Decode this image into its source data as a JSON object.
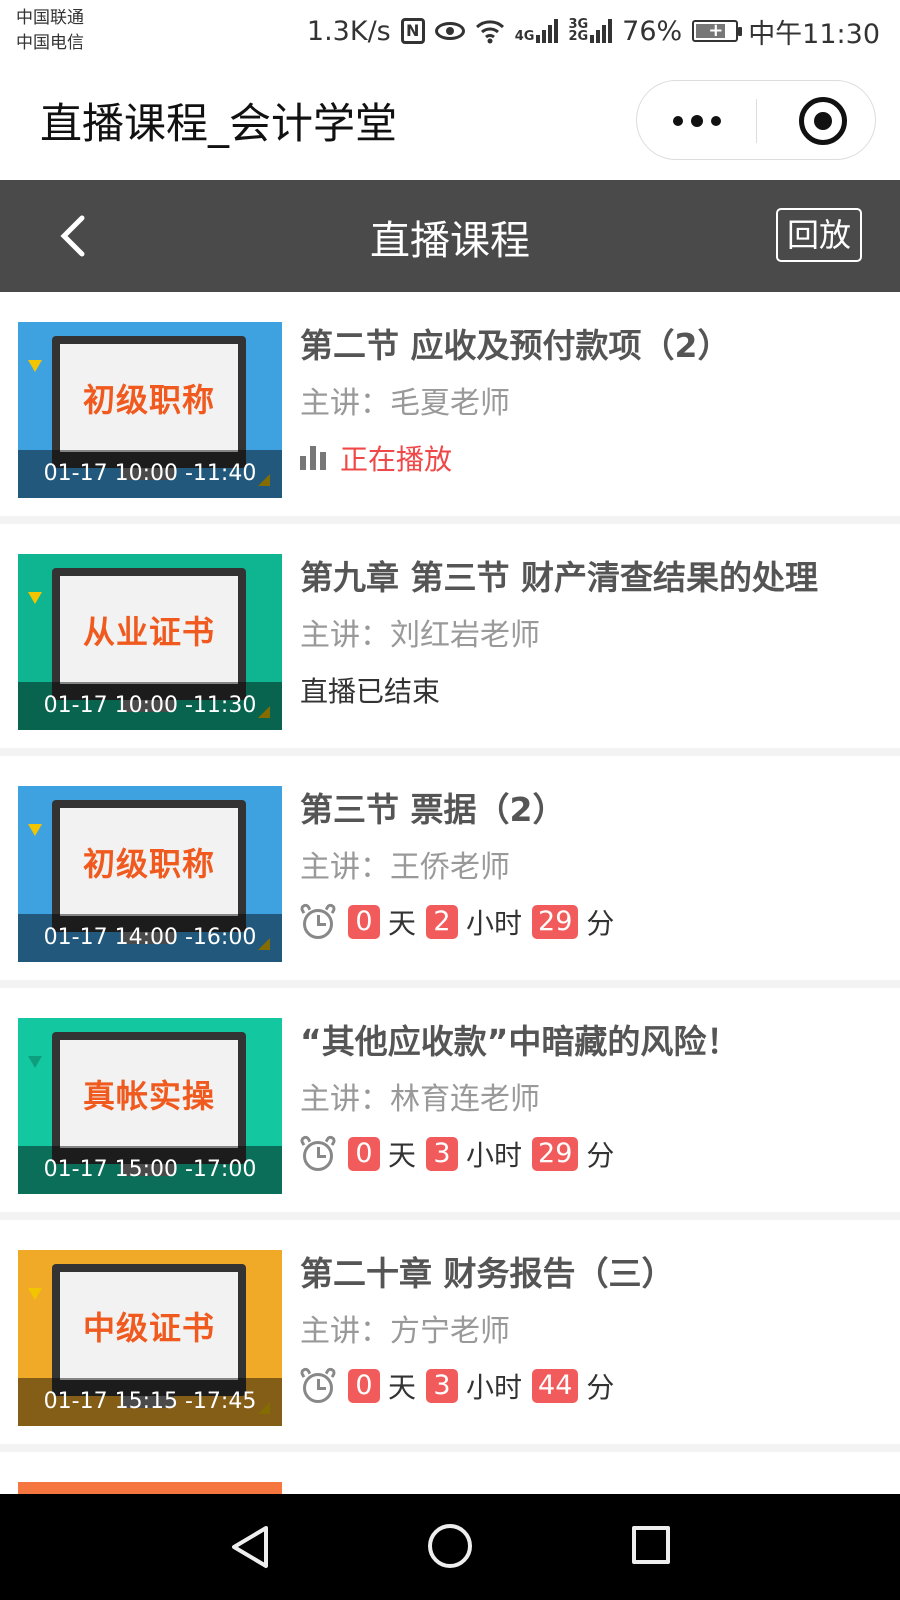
{
  "status_bar": {
    "carrier1": "中国联通",
    "carrier2": "中国电信",
    "speed": "1.3K/s",
    "net1": "4G",
    "net2a": "3G",
    "net2b": "2G",
    "battery": "76%",
    "time": "中午11:30"
  },
  "mini_program": {
    "title": "直播课程_会计学堂"
  },
  "navbar": {
    "title": "直播课程",
    "replay_label": "回放"
  },
  "courses": [
    {
      "thumb_label": "初级职称",
      "thumb_color": "#3ea1e0",
      "time_range": "01-17 10:00 -11:40",
      "title": "第二节 应收及预付款项（2）",
      "teacher": "主讲：毛夏老师",
      "status": "正在播放"
    },
    {
      "thumb_label": "从业证书",
      "thumb_color": "#0fb491",
      "time_range": "01-17 10:00 -11:30",
      "title": "第九章 第三节 财产清查结果的处理",
      "teacher": "主讲：刘红岩老师",
      "status": "直播已结束"
    },
    {
      "thumb_label": "初级职称",
      "thumb_color": "#3ea1e0",
      "time_range": "01-17 14:00 -16:00",
      "title": "第三节 票据（2）",
      "teacher": "主讲：王侨老师",
      "countdown": {
        "days": "0",
        "days_unit": "天",
        "hours": "2",
        "hours_unit": "小时",
        "minutes": "29",
        "minutes_unit": "分"
      }
    },
    {
      "thumb_label": "真帐实操",
      "thumb_color": "#13c8a0",
      "time_range": "01-17 15:00 -17:00",
      "title": "“其他应收款”中暗藏的风险！",
      "teacher": "主讲：林育连老师",
      "countdown": {
        "days": "0",
        "days_unit": "天",
        "hours": "3",
        "hours_unit": "小时",
        "minutes": "29",
        "minutes_unit": "分"
      }
    },
    {
      "thumb_label": "中级证书",
      "thumb_color": "#f0aa28",
      "time_range": "01-17 15:15 -17:45",
      "title": "第二十章 财务报告（三）",
      "teacher": "主讲：方宁老师",
      "countdown": {
        "days": "0",
        "days_unit": "天",
        "hours": "3",
        "hours_unit": "小时",
        "minutes": "44",
        "minutes_unit": "分"
      }
    }
  ],
  "icons": {
    "back": "chevron-left-icon",
    "more": "more-dots-icon",
    "close": "target-icon",
    "playing": "bar-chart-icon",
    "alarm": "alarm-clock-icon"
  }
}
